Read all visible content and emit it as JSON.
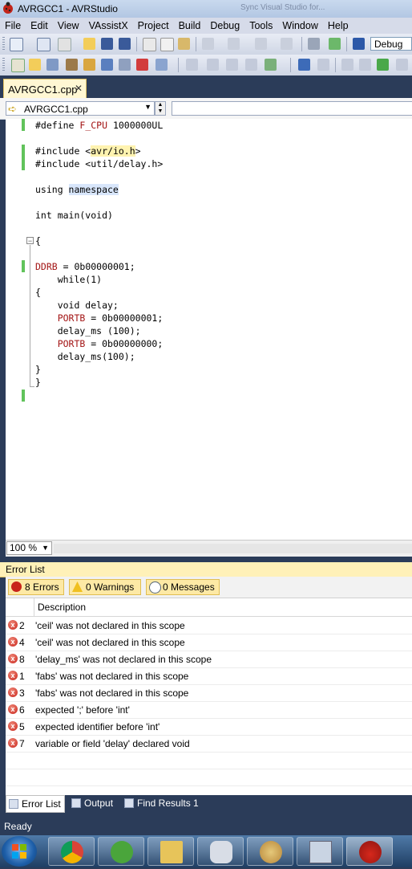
{
  "window": {
    "title": "AVRGCC1 - AVRStudio",
    "background_title": "Sync Visual Studio for..."
  },
  "menu": [
    "File",
    "Edit",
    "View",
    "VAssistX",
    "Project",
    "Build",
    "Debug",
    "Tools",
    "Window",
    "Help"
  ],
  "toolbar": {
    "configuration": "Debug"
  },
  "document_tab": {
    "label": "AVRGCC1.cpp",
    "close": "✕"
  },
  "navbar": {
    "scope": "AVRGCC1.cpp"
  },
  "code_lines": [
    "#define F_CPU 1000000UL",
    "",
    "#include <avr/io.h>",
    "#include <util/delay.h>",
    "",
    "using namespace",
    "",
    "int main(void)",
    "",
    "{",
    "",
    "DDRB = 0b00000001;",
    "    while(1)",
    "{",
    "    void delay;",
    "    PORTB = 0b00000001;",
    "    delay_ms (100);",
    "    PORTB = 0b00000000;",
    "    delay_ms(100);",
    "}",
    "}"
  ],
  "zoom": "100 %",
  "error_panel": {
    "title": "Error List",
    "filters": {
      "errors": "8 Errors",
      "warnings": "0 Warnings",
      "messages": "0 Messages"
    },
    "column_description": "Description",
    "rows": [
      {
        "num": "2",
        "message": "'ceil' was not declared in this scope"
      },
      {
        "num": "4",
        "message": "'ceil' was not declared in this scope"
      },
      {
        "num": "8",
        "message": "'delay_ms' was not declared in this scope"
      },
      {
        "num": "1",
        "message": "'fabs' was not declared in this scope"
      },
      {
        "num": "3",
        "message": "'fabs' was not declared in this scope"
      },
      {
        "num": "6",
        "message": "expected ';' before 'int'"
      },
      {
        "num": "5",
        "message": "expected identifier before 'int'"
      },
      {
        "num": "7",
        "message": "variable or field 'delay' declared void"
      }
    ]
  },
  "tool_tabs": [
    "Error List",
    "Output",
    "Find Results 1"
  ],
  "status": "Ready",
  "colors": {
    "accent": "#2b3c59",
    "highlight": "#fff1b8",
    "change_bar": "#61c35b",
    "error": "#c8231a"
  }
}
